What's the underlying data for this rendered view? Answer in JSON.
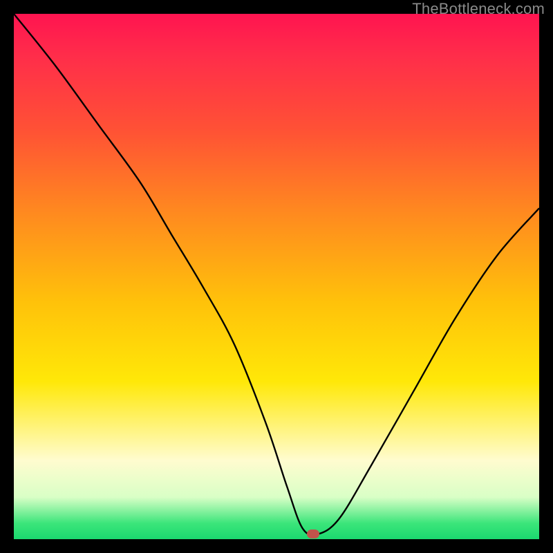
{
  "watermark": "TheBottleneck.com",
  "marker": {
    "x_pct": 57,
    "y_pct": 99
  },
  "chart_data": {
    "type": "line",
    "title": "",
    "xlabel": "",
    "ylabel": "",
    "xlim": [
      0,
      100
    ],
    "ylim": [
      0,
      100
    ],
    "series": [
      {
        "name": "bottleneck-curve",
        "x": [
          0,
          8,
          16,
          24,
          30,
          36,
          42,
          48,
          52,
          55,
          58,
          62,
          68,
          76,
          84,
          92,
          100
        ],
        "y": [
          100,
          90,
          79,
          68,
          58,
          48,
          37,
          22,
          10,
          2,
          1,
          4,
          14,
          28,
          42,
          54,
          63
        ]
      }
    ],
    "gradient_stops": [
      {
        "pct": 0,
        "color": "#ff1450"
      },
      {
        "pct": 8,
        "color": "#ff2d4a"
      },
      {
        "pct": 22,
        "color": "#ff5135"
      },
      {
        "pct": 38,
        "color": "#ff8a1f"
      },
      {
        "pct": 55,
        "color": "#ffc20a"
      },
      {
        "pct": 70,
        "color": "#ffe808"
      },
      {
        "pct": 85,
        "color": "#fffccf"
      },
      {
        "pct": 92,
        "color": "#d9ffc6"
      },
      {
        "pct": 97,
        "color": "#3be57a"
      },
      {
        "pct": 100,
        "color": "#1bd96f"
      }
    ]
  }
}
